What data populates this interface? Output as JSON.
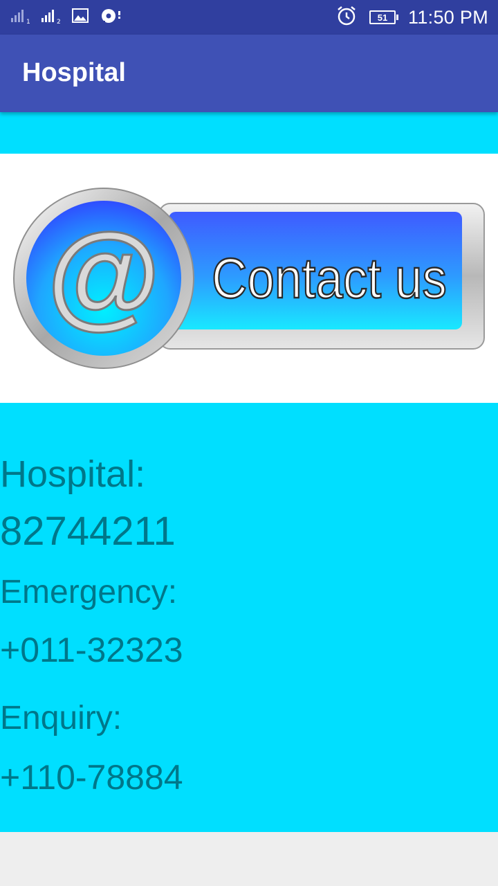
{
  "status_bar": {
    "time": "11:50 PM",
    "battery_level": "51",
    "icons": [
      "signal-sim1-icon",
      "signal-sim2-icon",
      "image-icon",
      "sync-icon",
      "alarm-icon",
      "battery-icon"
    ]
  },
  "app_bar": {
    "title": "Hospital"
  },
  "banner": {
    "text": "Contact us",
    "symbol": "@"
  },
  "contacts": {
    "hospital_label": "Hospital:",
    "hospital_number": "82744211",
    "emergency_label": "Emergency:",
    "emergency_number": "+011-32323",
    "enquiry_label": "Enquiry:",
    "enquiry_number": "+110-78884"
  },
  "colors": {
    "status_bar": "#303f9f",
    "app_bar": "#3f51b5",
    "content_background": "#00dfff",
    "contact_text": "#00778a"
  }
}
